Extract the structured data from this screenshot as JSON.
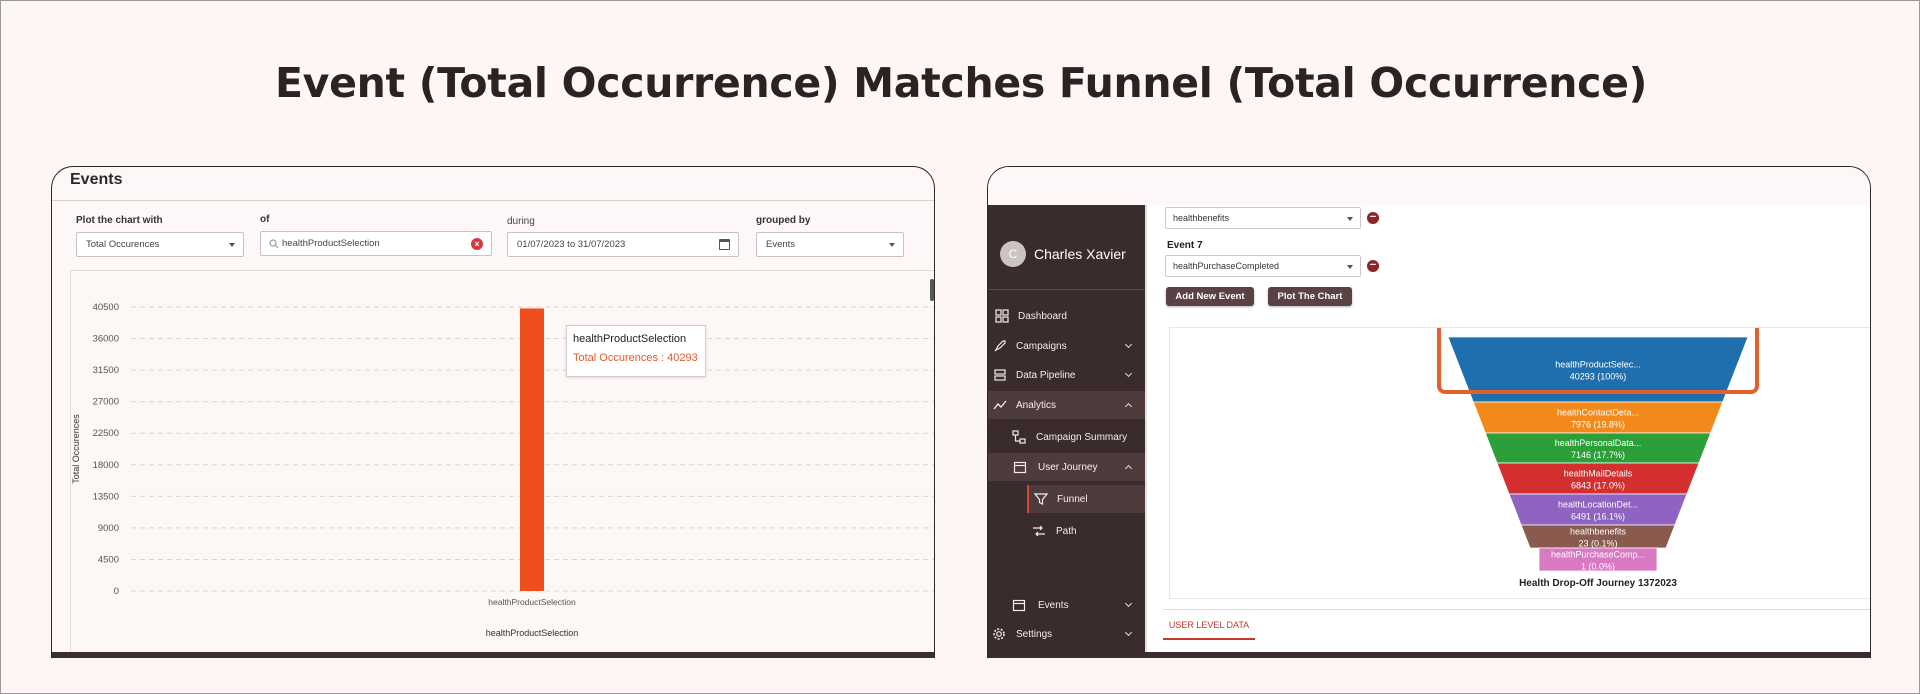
{
  "headline": "Event (Total Occurrence) Matches Funnel (Total Occurrence)",
  "left_panel": {
    "title": "Events",
    "filters": {
      "plot_label": "Plot the chart with",
      "plot_value": "Total Occurences",
      "of_label": "of",
      "of_value": "healthProductSelection",
      "during_label": "during",
      "during_value": "01/07/2023 to 31/07/2023",
      "grouped_label": "grouped by",
      "grouped_value": "Events"
    },
    "tooltip": {
      "title": "healthProductSelection",
      "value": "Total Occurences : 40293"
    }
  },
  "chart_data": [
    {
      "type": "bar",
      "categories": [
        "healthProductSelection"
      ],
      "values": [
        40293
      ],
      "ylabel": "Total Occurences",
      "xlabel": "healthProductSelection",
      "y_ticks": [
        0,
        4500,
        9000,
        13500,
        18000,
        22500,
        27000,
        31500,
        36000,
        40500
      ],
      "ylim": [
        0,
        40500
      ],
      "grid": true,
      "color": "#ef4e1d"
    },
    {
      "type": "funnel",
      "title": "Health Drop-Off Journey 1372023",
      "stages": [
        {
          "name": "healthProductSelec...",
          "value": 40293,
          "pct": "100%",
          "label": "40293 (100%)",
          "color": "#1f6fae"
        },
        {
          "name": "healthContactDeta...",
          "value": 7976,
          "pct": "19.8%",
          "label": "7976 (19.8%)",
          "color": "#f18a1b"
        },
        {
          "name": "healthPersonalData...",
          "value": 7146,
          "pct": "17.7%",
          "label": "7146 (17.7%)",
          "color": "#2c9f39"
        },
        {
          "name": "healthMailDetails",
          "value": 6843,
          "pct": "17.0%",
          "label": "6843 (17.0%)",
          "color": "#d32f2f"
        },
        {
          "name": "healthLocationDet...",
          "value": 6491,
          "pct": "16.1%",
          "label": "6491 (16.1%)",
          "color": "#8f63c2"
        },
        {
          "name": "healthbenefits",
          "value": 23,
          "pct": "0.1%",
          "label": "23 (0.1%)",
          "color": "#8a5a4f"
        },
        {
          "name": "healthPurchaseComp...",
          "value": 1,
          "pct": "0.0%",
          "label": "1 (0.0%)",
          "color": "#d879c2"
        }
      ],
      "highlight_color": "#e35f2b"
    }
  ],
  "right_panel": {
    "user_initial": "C",
    "user_name": "Charles Xavier",
    "nav": {
      "dashboard": "Dashboard",
      "campaigns": "Campaigns",
      "data_pipeline": "Data Pipeline",
      "analytics": "Analytics",
      "campaign_summary": "Campaign Summary",
      "user_journey": "User Journey",
      "funnel": "Funnel",
      "path": "Path",
      "events": "Events",
      "settings": "Settings"
    },
    "event6_value": "healthbenefits",
    "event7_label": "Event 7",
    "event7_value": "healthPurchaseCompleted",
    "add_event_label": "Add New Event",
    "plot_chart_label": "Plot The Chart",
    "tab_label": "USER LEVEL DATA"
  }
}
